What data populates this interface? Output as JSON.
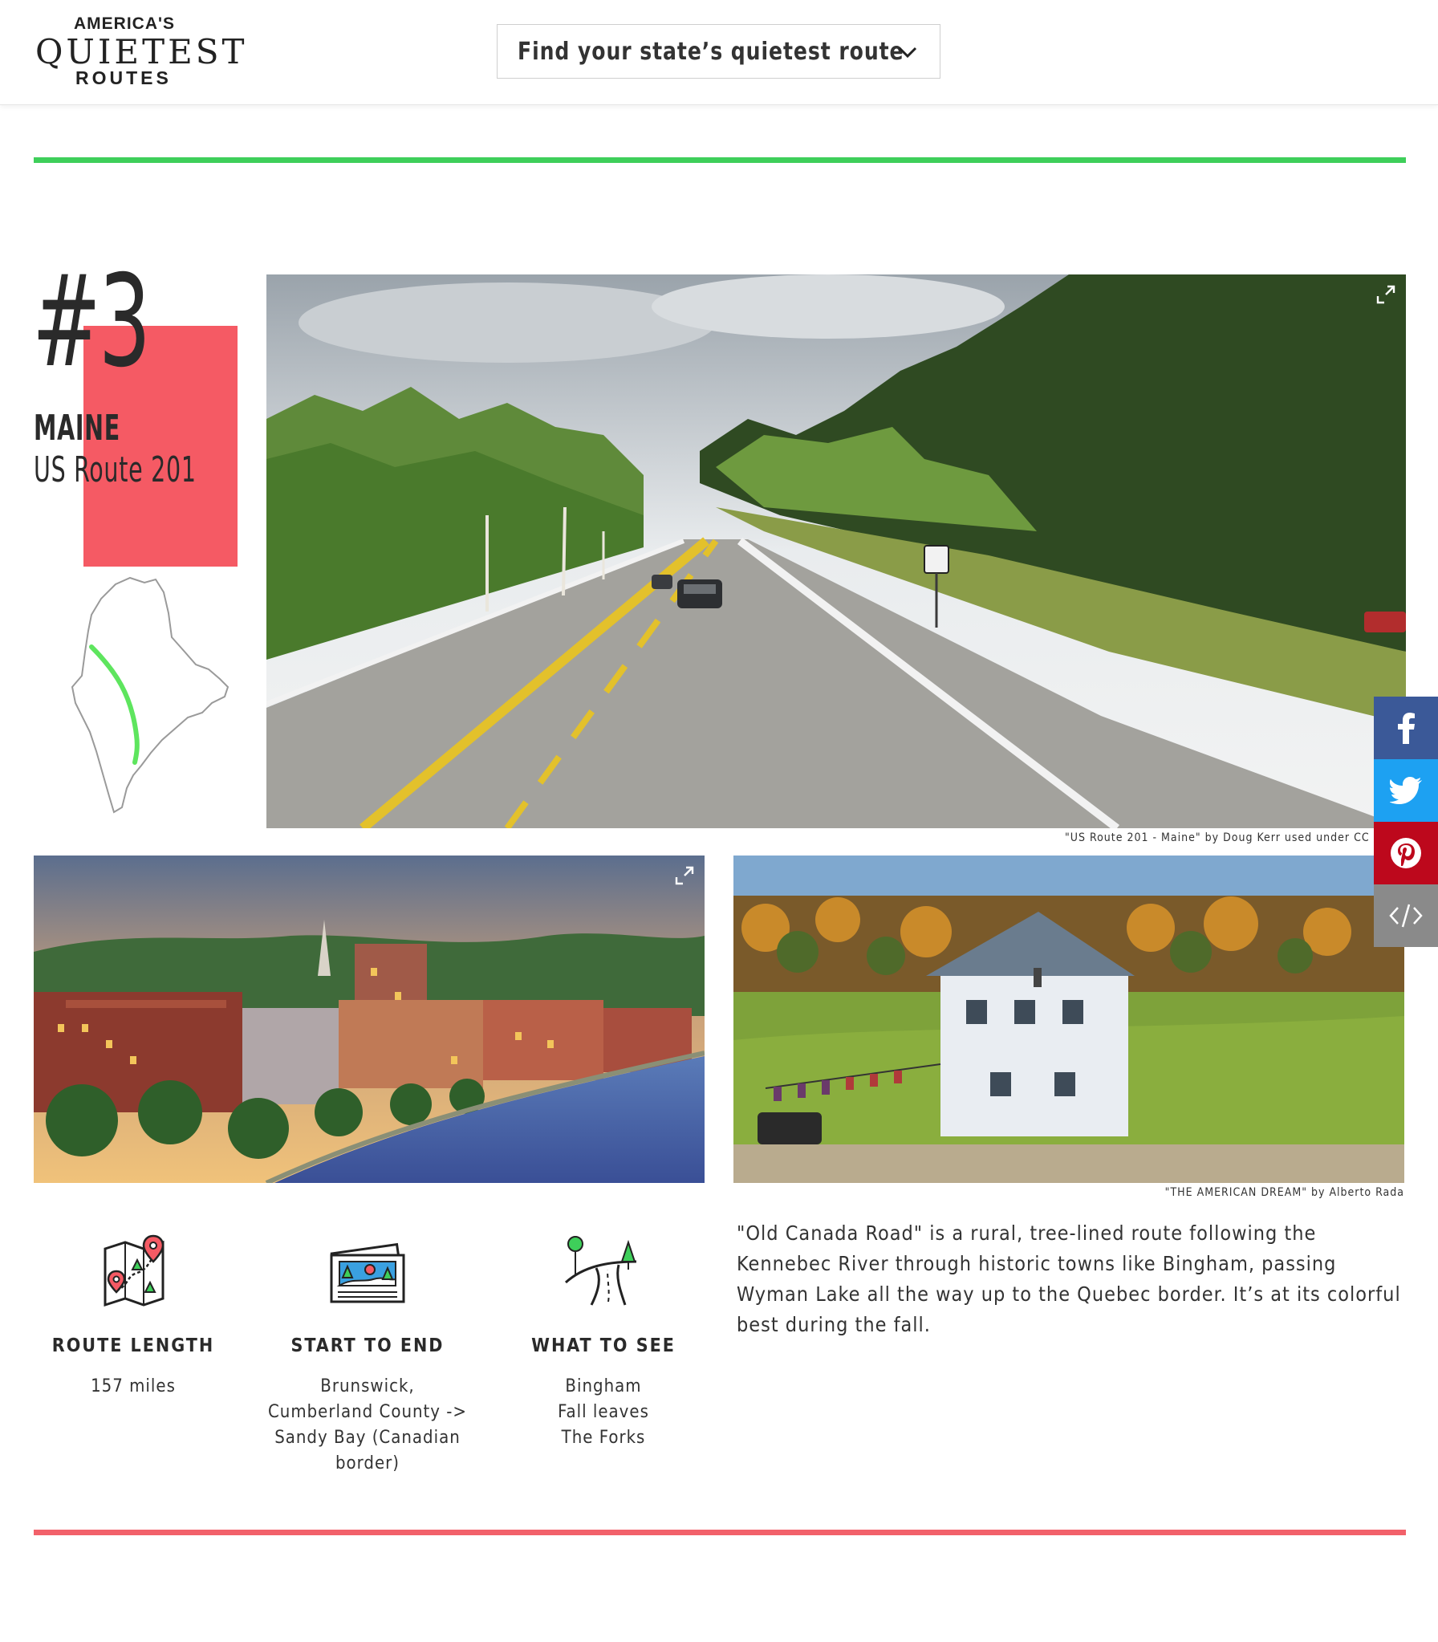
{
  "header": {
    "logo": {
      "line1": "AMERICA'S",
      "line2": "QUIETEST",
      "line3": "ROUTES"
    },
    "route_selector": {
      "label": "Find your state’s quietest route",
      "icon": "chevron-down-icon"
    }
  },
  "colors": {
    "accent_green": "#3ecf5a",
    "accent_red": "#f55a64",
    "facebook": "#3b5998",
    "twitter": "#1da1f2",
    "pinterest": "#bd081c",
    "embed": "#8a8a8a"
  },
  "entry": {
    "rank": "#3",
    "state": "MAINE",
    "route": "US Route 201",
    "photos": {
      "main_caption": "\"US Route 201 - Maine\" by Doug Kerr used under CC BY-SA",
      "house_caption": "\"THE AMERICAN DREAM\" by Alberto Rada"
    },
    "info": [
      {
        "icon": "map-pins-icon",
        "title": "ROUTE LENGTH",
        "lines": [
          "157 miles"
        ]
      },
      {
        "icon": "landscape-photos-icon",
        "title": "START TO END",
        "lines": [
          "Brunswick,",
          "Cumberland County ->",
          "Sandy Bay (Canadian",
          "border)"
        ]
      },
      {
        "icon": "winding-road-icon",
        "title": "WHAT TO SEE",
        "lines": [
          "Bingham",
          "Fall leaves",
          "The Forks"
        ]
      }
    ],
    "description": "\"Old Canada Road\" is a rural, tree-lined route following the Kennebec River through historic towns like Bingham, passing Wyman Lake all the way up to the Quebec border. It’s at its colorful best during the fall."
  },
  "share": {
    "facebook": "facebook-icon",
    "twitter": "twitter-icon",
    "pinterest": "pinterest-icon",
    "embed": "embed-code-icon"
  }
}
